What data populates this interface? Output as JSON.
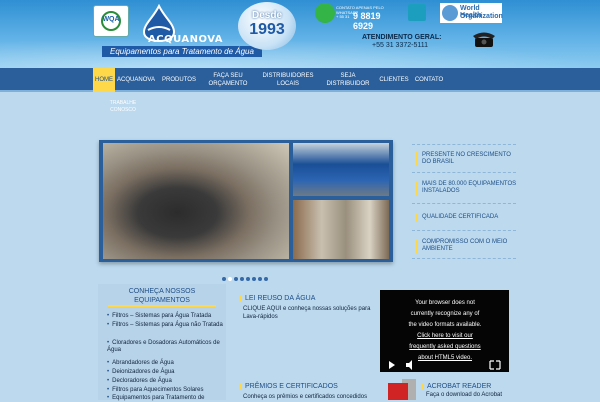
{
  "header": {
    "wqa_label": "WQA",
    "logo_name": "ACQUANOVA",
    "logo_tagline": "Equipamentos para Tratamento de Água",
    "badge_line1": "Desde",
    "badge_line2": "1993",
    "whatsapp_small": "CONTATO APENAS PELO WHATSAPP",
    "whatsapp_number": "9 8819 6929",
    "whatsapp_prefix": "+ 55 31",
    "who_line1": "World Health",
    "who_line2": "Organization",
    "contact_title": "ATENDIMENTO GERAL:",
    "contact_phone": "+55 31 3372-5111"
  },
  "nav": {
    "items": [
      "HOME",
      "ACQUANOVA",
      "PRODUTOS",
      "FAÇA SEU ORÇAMENTO",
      "DISTRIBUIDORES LOCAIS",
      "SEJA DISTRIBUIDOR",
      "CLIENTES",
      "CONTATO"
    ],
    "sub_item": "TRABALHE CONOSCO"
  },
  "right_list": [
    "PRESENTE NO CRESCIMENTO DO BRASIL",
    "MAIS DE 80.000 EQUIPAMENTOS INSTALADOS",
    "QUALIDADE CERTIFICADA",
    "COMPROMISSO COM O MEIO AMBIENTE"
  ],
  "slider": {
    "dot_count": 8,
    "active_dot": 1
  },
  "products": {
    "title": "Conheça nossos equipamentos",
    "items": [
      "Filtros – Sistemas para Água Tratada",
      "Filtros – Sistemas para Água não Tratada",
      "Cloradores e Dosadoras Automáticos de Água",
      "Abrandadores de Água",
      "Deionizadores de Água",
      "Decloradores de Água",
      "Filtros para Aquecimentos Solares",
      "Equipamentos para Tratamento de"
    ]
  },
  "reuso": {
    "title": "LEI REUSO DA ÁGUA",
    "text": "CLIQUE AQUI e conheça nossas soluções para Lava-rápidos"
  },
  "premios": {
    "title": "PRÊMIOS E CERTIFICADOS",
    "text": "Conheça os prêmios e certificados concedidos"
  },
  "video": {
    "line1": "Your browser does not",
    "line2": "currently recognize any of",
    "line3": "the video formats available.",
    "link1": "Click here to visit our",
    "link2": "frequently asked questions",
    "link3": "about HTML5 video."
  },
  "acrobat": {
    "title": "ACROBAT READER",
    "text": "Faça o download do Acrobat"
  }
}
